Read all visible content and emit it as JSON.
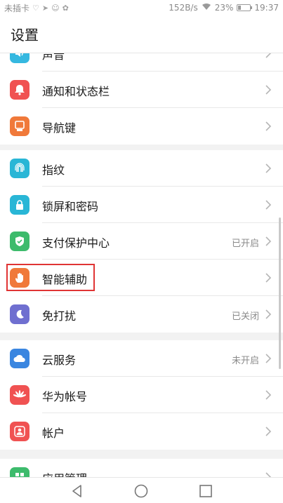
{
  "status_bar": {
    "carrier": "未插卡",
    "speed": "152B/s",
    "battery": "23%",
    "battery_level": 0.23,
    "time": "19:37"
  },
  "header": {
    "title": "设置"
  },
  "items": [
    {
      "label": "声音",
      "icon": "speaker-icon",
      "color": "#35b8e0"
    },
    {
      "label": "通知和状态栏",
      "icon": "bell-icon",
      "color": "#f05252"
    },
    {
      "label": "导航键",
      "icon": "navigation-key-icon",
      "color": "#f0793a"
    },
    {
      "label": "指纹",
      "icon": "fingerprint-icon",
      "color": "#29b6d6"
    },
    {
      "label": "锁屏和密码",
      "icon": "lock-icon",
      "color": "#29b6d6"
    },
    {
      "label": "支付保护中心",
      "status": "已开启",
      "icon": "shield-icon",
      "color": "#3dbb6c"
    },
    {
      "label": "智能辅助",
      "icon": "hand-icon",
      "color": "#f0793a"
    },
    {
      "label": "免打扰",
      "status": "已关闭",
      "icon": "moon-icon",
      "color": "#6f6fd0"
    },
    {
      "label": "云服务",
      "status": "未开启",
      "icon": "cloud-icon",
      "color": "#3a86e0"
    },
    {
      "label": "华为帐号",
      "icon": "huawei-logo-icon",
      "color": "#f05252"
    },
    {
      "label": "帐户",
      "icon": "account-icon",
      "color": "#f05252"
    },
    {
      "label": "应用管理",
      "icon": "apps-icon",
      "color": "#3dbb6c"
    }
  ],
  "colors": {
    "highlight": "#e03434",
    "background": "#f2f2f2"
  }
}
